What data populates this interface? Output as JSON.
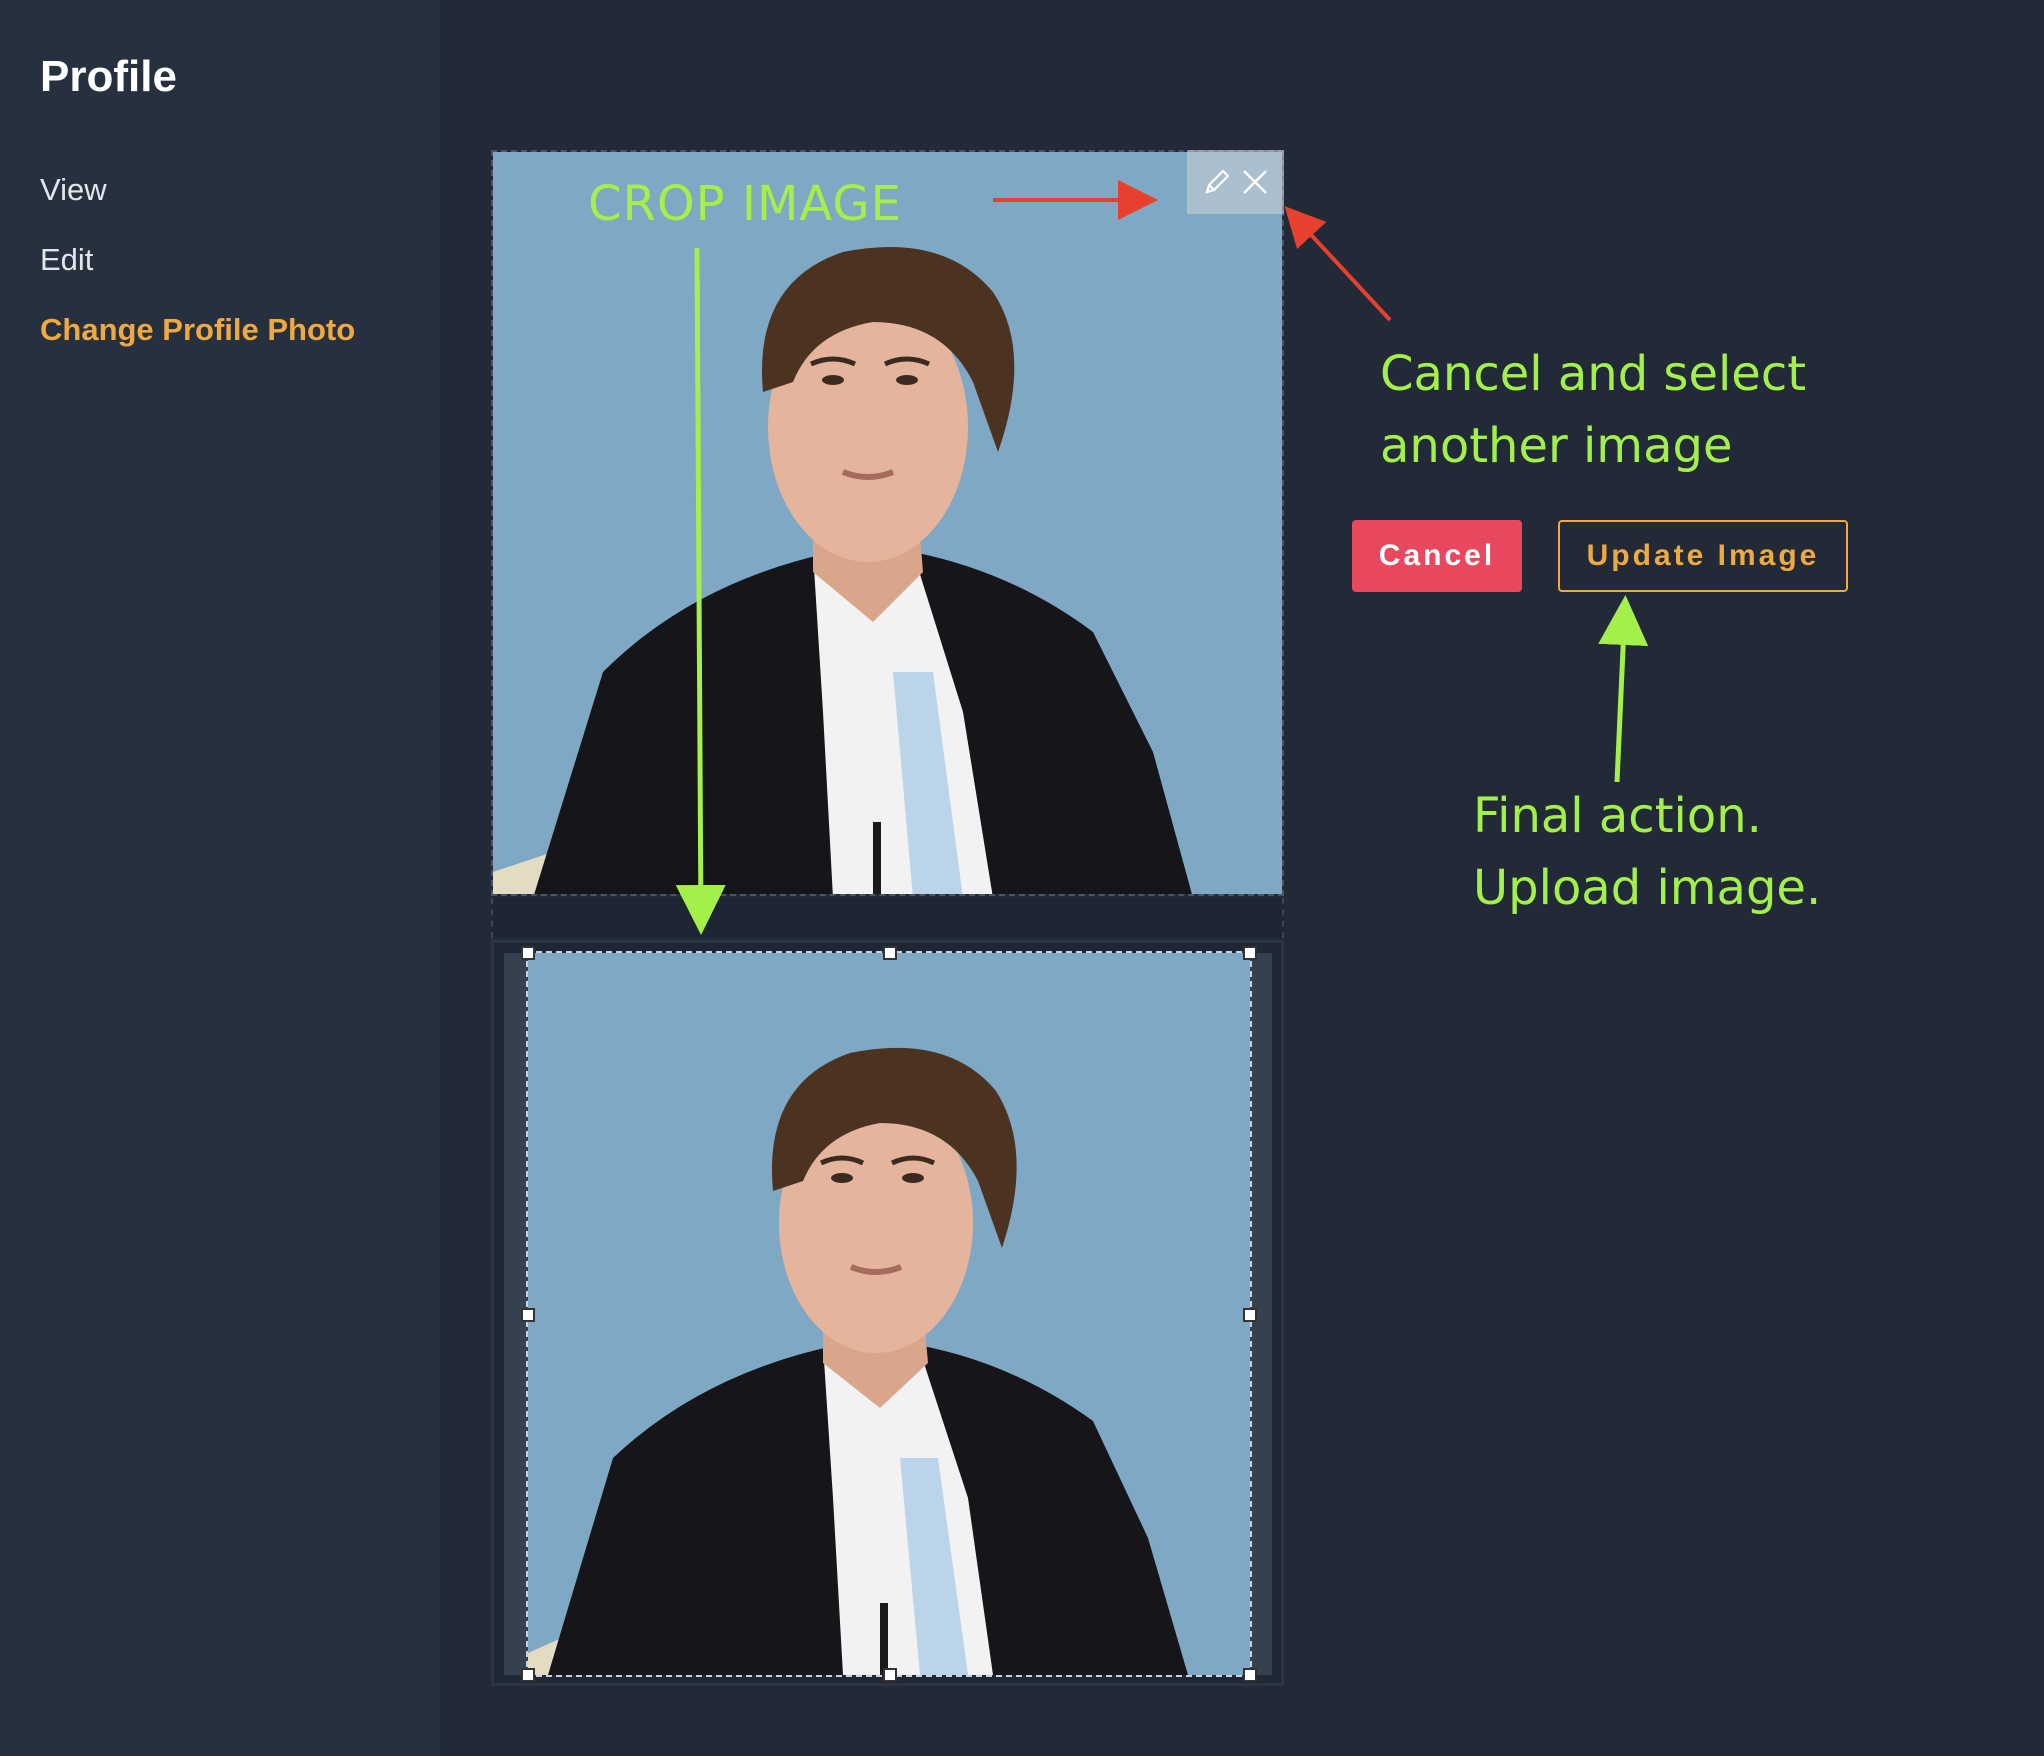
{
  "sidebar": {
    "title": "Profile",
    "items": [
      {
        "label": "View",
        "active": false
      },
      {
        "label": "Edit",
        "active": false
      },
      {
        "label": "Change Profile Photo",
        "active": true
      }
    ]
  },
  "preview": {
    "toolbar": {
      "edit_icon": "pencil-icon",
      "close_icon": "close-icon"
    }
  },
  "actions": {
    "cancel_label": "Cancel",
    "update_label": "Update Image"
  },
  "annotations": {
    "crop": "CROP IMAGE",
    "cancel_line1": "Cancel and select",
    "cancel_line2": "another image",
    "final_line1": "Final action.",
    "final_line2": "Upload image."
  },
  "colors": {
    "background": "#222a37",
    "sidebar": "#26303f",
    "accent": "#f0a940",
    "cancel": "#e8485e",
    "annotation_green": "#a3f04a",
    "annotation_red": "#e8402e",
    "photo_background": "#7ea8c3"
  }
}
